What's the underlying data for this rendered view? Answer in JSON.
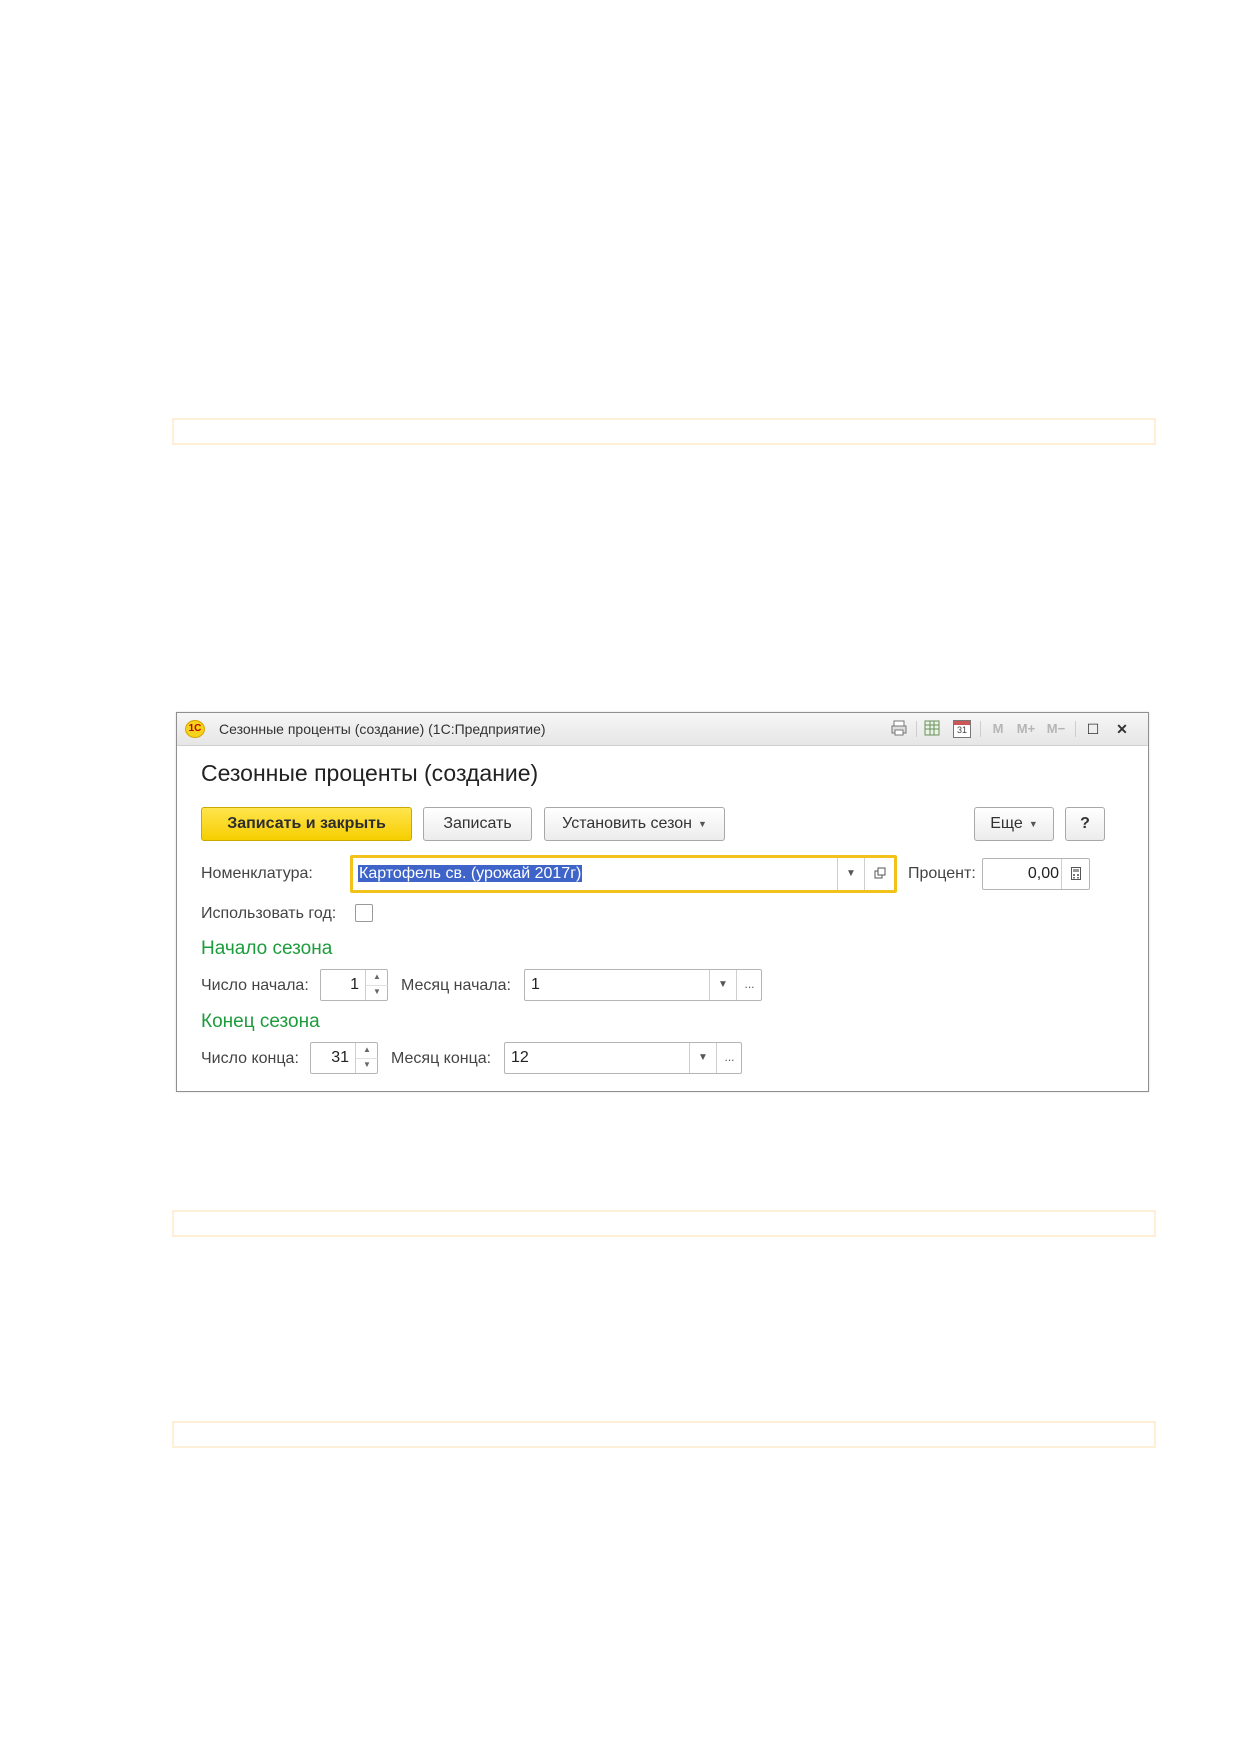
{
  "window": {
    "title": "Сезонные проценты (создание)  (1С:Предприятие)",
    "logo_text": "1С",
    "toolbar_icons": [
      "print-icon",
      "spreadsheet-icon",
      "calendar-icon"
    ],
    "calendar_day": "31",
    "memory_buttons": [
      "M",
      "M+",
      "M−"
    ],
    "maximize_glyph": "☐",
    "close_glyph": "✕"
  },
  "form": {
    "title": "Сезонные проценты (создание)",
    "buttons": {
      "save_close": "Записать и закрыть",
      "save": "Записать",
      "set_season": "Установить сезон",
      "more": "Еще",
      "help": "?"
    },
    "nomenclature": {
      "label": "Номенклатура:",
      "value": "Картофель св. (урожай 2017г)"
    },
    "percent": {
      "label": "Процент:",
      "value": "0,00"
    },
    "use_year": {
      "label": "Использовать год:",
      "checked": false
    },
    "season_start": {
      "heading": "Начало сезона",
      "day_label": "Число начала:",
      "day_value": "1",
      "month_label": "Месяц начала:",
      "month_value": "1"
    },
    "season_end": {
      "heading": "Конец сезона",
      "day_label": "Число конца:",
      "day_value": "31",
      "month_label": "Месяц конца:",
      "month_value": "12"
    },
    "ellipsis": "..."
  },
  "colors": {
    "accent_yellow": "#f6cf00",
    "section_green": "#1c9c3c",
    "focus_border": "#f0c21a",
    "selection": "#3e63c9"
  }
}
